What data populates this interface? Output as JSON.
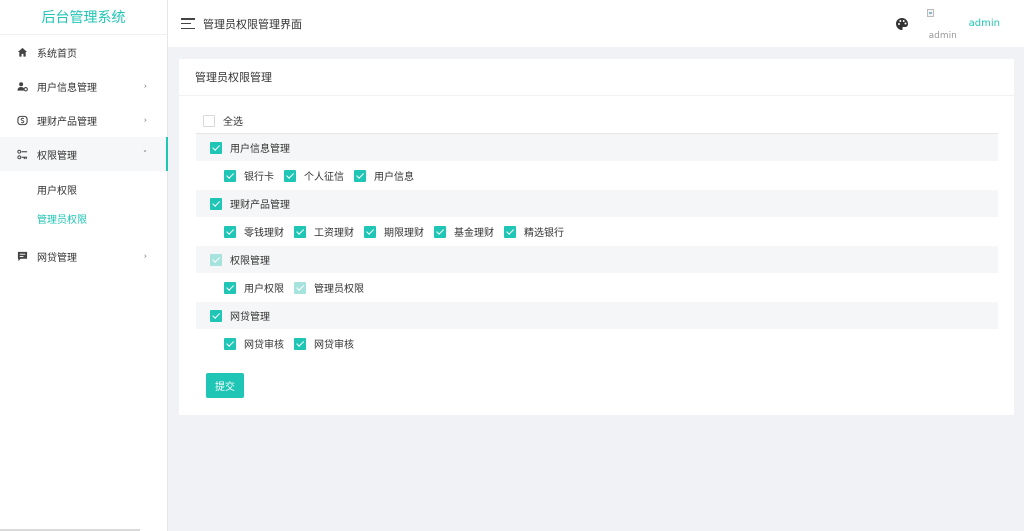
{
  "sidebar": {
    "brand": "后台管理系统",
    "items": [
      {
        "label": "系统首页",
        "icon": "home-icon"
      },
      {
        "label": "用户信息管理",
        "icon": "user-gear-icon"
      },
      {
        "label": "理财产品管理",
        "icon": "finance-icon"
      },
      {
        "label": "权限管理",
        "icon": "permission-icon",
        "open": true,
        "children": [
          {
            "label": "用户权限"
          },
          {
            "label": "管理员权限",
            "active": true
          }
        ]
      },
      {
        "label": "网贷管理",
        "icon": "message-icon"
      }
    ],
    "arrow": "›",
    "arrow_open": "˅"
  },
  "header": {
    "title": "管理员权限管理界面",
    "avatar_alt": "admin",
    "username": "admin"
  },
  "card": {
    "title": "管理员权限管理",
    "select_all": "全选",
    "groups": [
      {
        "label": "用户信息管理",
        "state": "checked",
        "children": [
          {
            "label": "银行卡",
            "state": "checked"
          },
          {
            "label": "个人征信",
            "state": "checked"
          },
          {
            "label": "用户信息",
            "state": "checked"
          }
        ]
      },
      {
        "label": "理财产品管理",
        "state": "checked",
        "children": [
          {
            "label": "零钱理财",
            "state": "checked"
          },
          {
            "label": "工资理财",
            "state": "checked"
          },
          {
            "label": "期限理财",
            "state": "checked"
          },
          {
            "label": "基金理财",
            "state": "checked"
          },
          {
            "label": "精选银行",
            "state": "checked"
          }
        ]
      },
      {
        "label": "权限管理",
        "state": "disabled-checked",
        "children": [
          {
            "label": "用户权限",
            "state": "checked"
          },
          {
            "label": "管理员权限",
            "state": "disabled-checked"
          }
        ]
      },
      {
        "label": "网贷管理",
        "state": "checked",
        "children": [
          {
            "label": "网贷审核",
            "state": "checked"
          },
          {
            "label": "网贷审核",
            "state": "checked"
          }
        ]
      }
    ],
    "submit_label": "提交"
  },
  "colors": {
    "accent": "#1fc6b5",
    "accent_light": "#a5e3dc"
  }
}
